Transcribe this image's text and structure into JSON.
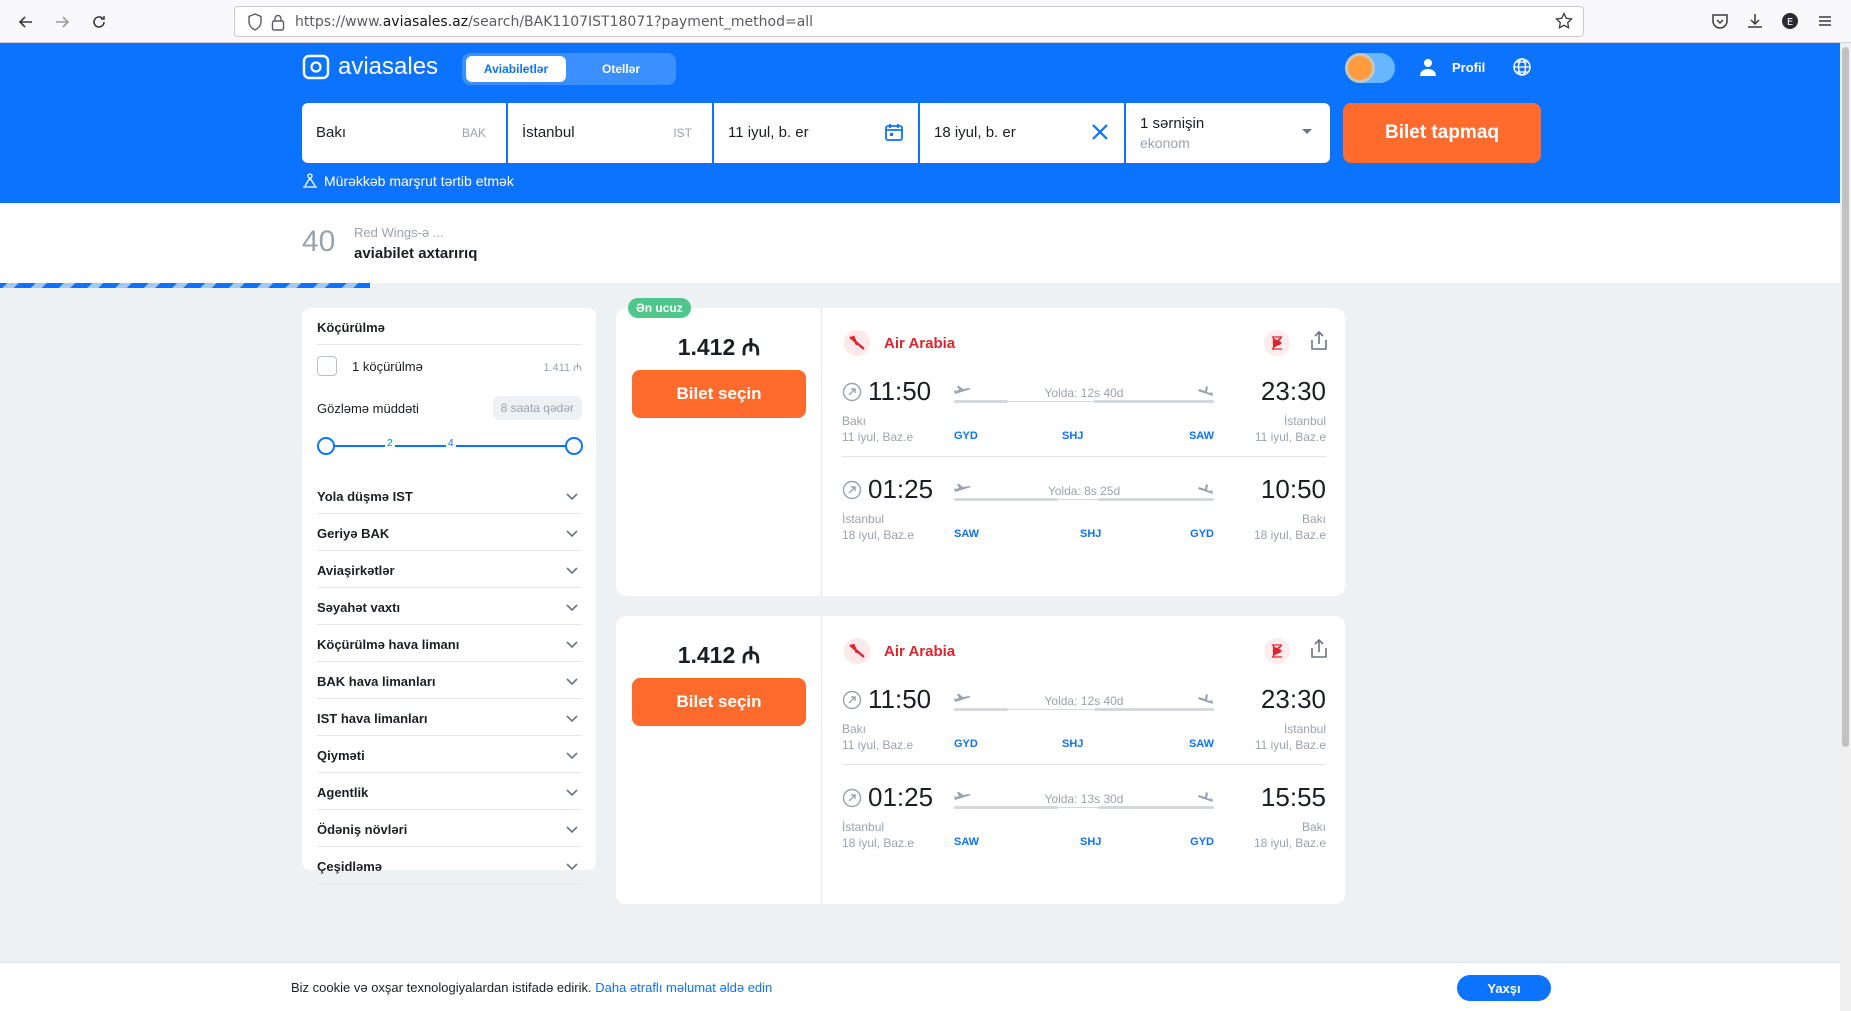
{
  "browser": {
    "url_prefix": "https://www.",
    "url_domain": "aviasales.az",
    "url_path": "/search/BAK1107IST18071?payment_method=all"
  },
  "header": {
    "logo_text": "aviasales",
    "tabs": [
      {
        "label": "Aviabiletlər",
        "active": true
      },
      {
        "label": "Otellər",
        "active": false
      }
    ],
    "profile_label": "Profil",
    "search": {
      "origin": "Bakı",
      "origin_code": "BAK",
      "destination": "İstanbul",
      "destination_code": "IST",
      "depart_date": "11 iyul, b. er",
      "return_date": "18 iyul, b. er",
      "passengers": "1 sərnişin",
      "cabin": "ekonom",
      "find_button": "Bilet tapmaq"
    },
    "complex_route": "Mürəkkəb marşrut tərtib etmək"
  },
  "progress": {
    "count": "40",
    "subtitle": "Red Wings-ə ...",
    "title": "aviabilet axtarırıq"
  },
  "filters": {
    "transfers_title": "Köçürülmə",
    "one_transfer_label": "1 köçürülmə",
    "one_transfer_price": "1.411 ₼",
    "wait_label": "Gözləmə müddəti",
    "wait_badge": "8 saata qədər",
    "slider_ticks": [
      "2",
      "4"
    ],
    "slider_range_hours": [
      0,
      8
    ],
    "rows": [
      "Yola düşmə IST",
      "Geriyə BAK",
      "Aviaşirkətlər",
      "Səyahət vaxtı",
      "Köçürülmə hava limanı",
      "BAK hava limanları",
      "IST hava limanları",
      "Qiyməti",
      "Agentlik",
      "Ödəniş növləri",
      "Çeşidləmə"
    ]
  },
  "tickets": [
    {
      "badge": "Ən ucuz",
      "price": "1.412 ₼",
      "select_label": "Bilet seçin",
      "airline": "Air Arabia",
      "segments": [
        {
          "dep_time": "11:50",
          "arr_time": "23:30",
          "duration": "Yolda: 12s 40d",
          "dep_city": "Bakı",
          "dep_date": "11 iyul, Baz.e",
          "arr_city": "İstanbul",
          "arr_date": "11 iyul, Baz.e",
          "airports": [
            "GYD",
            "SHJ",
            "SAW"
          ]
        },
        {
          "dep_time": "01:25",
          "arr_time": "10:50",
          "duration": "Yolda: 8s 25d",
          "dep_city": "İstanbul",
          "dep_date": "18 iyul, Baz.e",
          "arr_city": "Bakı",
          "arr_date": "18 iyul, Baz.e",
          "airports": [
            "SAW",
            "SHJ",
            "GYD"
          ]
        }
      ]
    },
    {
      "badge": "",
      "price": "1.412 ₼",
      "select_label": "Bilet seçin",
      "airline": "Air Arabia",
      "segments": [
        {
          "dep_time": "11:50",
          "arr_time": "23:30",
          "duration": "Yolda: 12s 40d",
          "dep_city": "Bakı",
          "dep_date": "11 iyul, Baz.e",
          "arr_city": "İstanbul",
          "arr_date": "11 iyul, Baz.e",
          "airports": [
            "GYD",
            "SHJ",
            "SAW"
          ]
        },
        {
          "dep_time": "01:25",
          "arr_time": "15:55",
          "duration": "Yolda: 13s 30d",
          "dep_city": "İstanbul",
          "dep_date": "18 iyul, Baz.e",
          "arr_city": "Bakı",
          "arr_date": "18 iyul, Baz.e",
          "airports": [
            "SAW",
            "SHJ",
            "GYD"
          ]
        }
      ]
    }
  ],
  "cookie": {
    "text": "Biz cookie və oxşar texnologiyalardan istifadə edirik.",
    "link": "Daha ətraflı məlumat əldə edin",
    "ok": "Yaxşı"
  },
  "colors": {
    "brand_blue": "#0c73fe",
    "cta_orange": "#ff6b2c",
    "badge_green": "#4fc78a",
    "airline_red": "#e0242e"
  }
}
